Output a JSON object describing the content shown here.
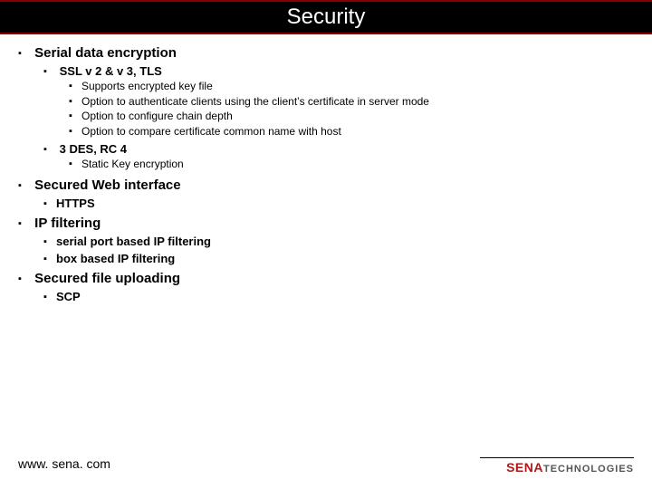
{
  "title": "Security",
  "bullets": {
    "b1": "Serial data encryption",
    "b1_1": "SSL v 2 & v 3, TLS",
    "b1_1_1": "Supports encrypted key file",
    "b1_1_2": "Option to authenticate clients using the client’s certificate in server mode",
    "b1_1_3": "Option to configure chain depth",
    "b1_1_4": "Option to compare certificate common name with host",
    "b1_2": "3 DES, RC 4",
    "b1_2_1": "Static Key encryption",
    "b2": "Secured Web interface",
    "b2_1": "HTTPS",
    "b3": "IP filtering",
    "b3_1": "serial port based IP filtering",
    "b3_2": "box based IP filtering",
    "b4": "Secured file uploading",
    "b4_1": "SCP"
  },
  "footer_url": "www. sena. com",
  "logo": {
    "brand": "SENA",
    "suffix": "TECHNOLOGIES"
  },
  "colors": {
    "title_bg": "#000000",
    "accent": "#8b0000",
    "logo_red": "#b01818"
  }
}
